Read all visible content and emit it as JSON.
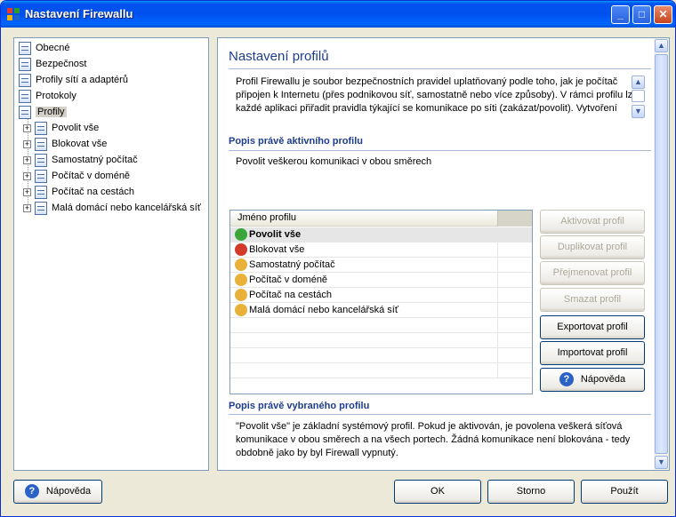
{
  "window": {
    "title": "Nastavení Firewallu",
    "controls": {
      "minimize": "_",
      "maximize": "□",
      "close": "✕"
    }
  },
  "tree": {
    "items": [
      {
        "label": "Obecné",
        "icon": "page-icon"
      },
      {
        "label": "Bezpečnost",
        "icon": "page-icon"
      },
      {
        "label": "Profily sítí a adaptérů",
        "icon": "page-icon"
      },
      {
        "label": "Protokoly",
        "icon": "page-icon"
      },
      {
        "label": "Profily",
        "icon": "page-icon",
        "selected": true
      }
    ],
    "profiles": [
      {
        "label": "Povolit vše",
        "expander": "+"
      },
      {
        "label": "Blokovat vše",
        "expander": "+"
      },
      {
        "label": "Samostatný počítač",
        "expander": "+"
      },
      {
        "label": "Počítač v doméně",
        "expander": "+"
      },
      {
        "label": "Počítač na cestách",
        "expander": "+"
      },
      {
        "label": "Malá domácí nebo kancelářská síť",
        "expander": "+"
      }
    ]
  },
  "main": {
    "title": "Nastavení profilů",
    "intro": "Profil Firewallu je soubor bezpečnostních pravidel uplatňovaný podle toho, jak je počítač připojen k Internetu (přes podnikovou síť, samostatně nebo více způsoby). V rámci profilu lze každé aplikaci přiřadit pravidla týkající se komunikace po síti (zakázat/povolit). Vytvoření",
    "active_section_title": "Popis právě aktivního profilu",
    "active_description": "Povolit veškerou komunikaci v obou směrech",
    "list": {
      "column_header": "Jméno profilu",
      "rows": [
        {
          "label": "Povolit vše",
          "icon": "allow-icon",
          "selected": true
        },
        {
          "label": "Blokovat vše",
          "icon": "block-icon"
        },
        {
          "label": "Samostatný počítač",
          "icon": "user-icon"
        },
        {
          "label": "Počítač v doméně",
          "icon": "user-icon"
        },
        {
          "label": "Počítač na cestách",
          "icon": "user-icon"
        },
        {
          "label": "Malá domácí nebo kancelářská síť",
          "icon": "user-icon"
        }
      ]
    },
    "buttons": {
      "activate": "Aktivovat profil",
      "duplicate": "Duplikovat profil",
      "rename": "Přejmenovat profil",
      "delete": "Smazat profil",
      "export": "Exportovat profil",
      "import": "Importovat profil",
      "help": "Nápověda"
    },
    "selected_section_title": "Popis právě vybraného profilu",
    "selected_description": "\"Povolit vše\" je základní systémový profil. Pokud je aktivován, je povolena veškerá síťová komunikace v obou směrech a na všech portech. Žádná komunikace není blokována - tedy obdobně jako by byl Firewall vypnutý."
  },
  "footer": {
    "help": "Nápověda",
    "ok": "OK",
    "cancel": "Storno",
    "apply": "Použít"
  },
  "colors": {
    "title_bar": "#0053ee",
    "heading": "#1d3d8c",
    "allow": "#3aa53a",
    "block": "#d43a2a",
    "user": "#e7b13a"
  }
}
